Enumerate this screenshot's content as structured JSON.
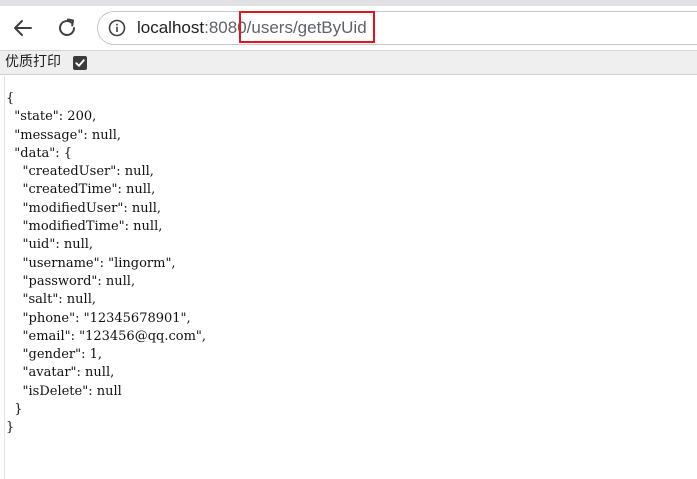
{
  "browser": {
    "url": {
      "host": "localhost",
      "port": ":8080",
      "path": "/users/getByUid"
    }
  },
  "toolbar": {
    "back_icon": "arrow-left-icon",
    "reload_icon": "reload-icon",
    "site_info_icon": "info-icon"
  },
  "pretty_print": {
    "label": "优质打印",
    "checked": true
  },
  "colors": {
    "highlight": "#e0161b",
    "checkbox": "#3b3b3b"
  },
  "json_lines": [
    "{",
    "  \"state\": 200,",
    "  \"message\": null,",
    "  \"data\": {",
    "    \"createdUser\": null,",
    "    \"createdTime\": null,",
    "    \"modifiedUser\": null,",
    "    \"modifiedTime\": null,",
    "    \"uid\": null,",
    "    \"username\": \"lingorm\",",
    "    \"password\": null,",
    "    \"salt\": null,",
    "    \"phone\": \"12345678901\",",
    "    \"email\": \"123456@qq.com\",",
    "    \"gender\": 1,",
    "    \"avatar\": null,",
    "    \"isDelete\": null",
    "  }",
    "}"
  ]
}
